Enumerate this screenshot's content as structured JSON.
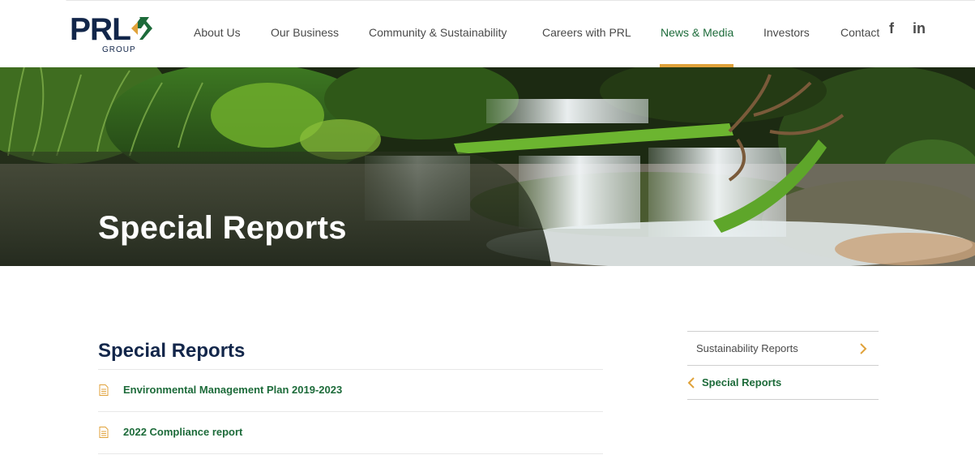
{
  "brand": {
    "logo_text": "PRL",
    "logo_subtext": "GROUP",
    "primary_color": "#12264a",
    "accent_green": "#1d6b3a",
    "accent_gold": "#e0a23a"
  },
  "nav": {
    "items": [
      {
        "label": "About Us",
        "active": false
      },
      {
        "label": "Our Business",
        "active": false
      },
      {
        "label": "Community & Sustainability",
        "active": false
      },
      {
        "label": "Careers with PRL",
        "active": false
      },
      {
        "label": "News & Media",
        "active": true
      },
      {
        "label": "Investors",
        "active": false
      },
      {
        "label": "Contact",
        "active": false
      }
    ],
    "social": [
      {
        "icon": "facebook-icon",
        "label": "f"
      },
      {
        "icon": "linkedin-icon",
        "label": "in"
      }
    ]
  },
  "hero": {
    "title": "Special Reports"
  },
  "main": {
    "title": "Special Reports",
    "reports": [
      {
        "label": "Environmental Management Plan 2019-2023",
        "icon": "document-icon"
      },
      {
        "label": "2022 Compliance report",
        "icon": "document-icon"
      }
    ]
  },
  "sidebar": {
    "items": [
      {
        "label": "Sustainability Reports",
        "icon": "chevron-right-icon"
      },
      {
        "label": "Special Reports",
        "icon": "chevron-left-icon",
        "active": true
      }
    ]
  }
}
